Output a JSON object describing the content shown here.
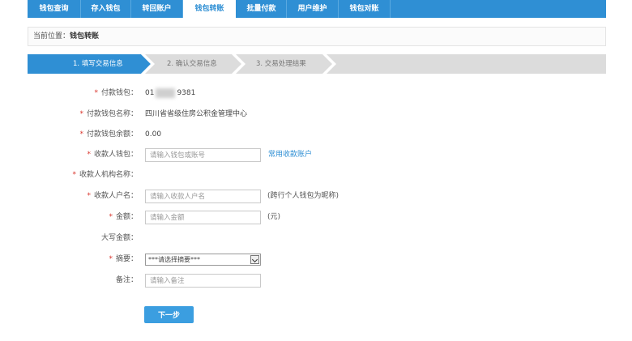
{
  "nav": {
    "tabs": [
      {
        "label": "钱包查询",
        "width": 66
      },
      {
        "label": "存入钱包",
        "width": 62
      },
      {
        "label": "转回账户",
        "width": 64
      },
      {
        "label": "钱包转账",
        "width": 66
      },
      {
        "label": "批量付款",
        "width": 62
      },
      {
        "label": "用户维护",
        "width": 64
      },
      {
        "label": "钱包对账",
        "width": 64
      }
    ],
    "active_index": 3
  },
  "breadcrumb": {
    "prefix": "当前位置：",
    "current": "钱包转账"
  },
  "steps": [
    {
      "label": "1. 填写交易信息",
      "active": true
    },
    {
      "label": "2. 确认交易信息",
      "active": false
    },
    {
      "label": "3. 交易处理结果",
      "active": false
    }
  ],
  "form": {
    "payer_wallet": {
      "label": "付款钱包：",
      "value_prefix": "01",
      "value_suffix": "9381",
      "required": true
    },
    "payer_name": {
      "label": "付款钱包名称：",
      "value": "四川省省级住房公积金管理中心",
      "required": true
    },
    "payer_balance": {
      "label": "付款钱包余额：",
      "value": "0.00",
      "required": true
    },
    "payee_wallet": {
      "label": "收款人钱包：",
      "placeholder": "请输入钱包或账号",
      "required": true,
      "link": "常用收款账户"
    },
    "payee_org": {
      "label": "收款人机构名称：",
      "required": true
    },
    "payee_name": {
      "label": "收款人户名：",
      "placeholder": "请输入收款人户名",
      "required": true,
      "hint": "(跨行个人钱包为昵称)"
    },
    "amount": {
      "label": "金额：",
      "placeholder": "请输入金额",
      "required": true,
      "hint": "(元)"
    },
    "amount_upper": {
      "label": "大写金额："
    },
    "summary": {
      "label": "摘要：",
      "selected": "***请选择摘要***",
      "required": true
    },
    "remark": {
      "label": "备注：",
      "placeholder": "请输入备注"
    }
  },
  "actions": {
    "next_label": "下一步"
  },
  "colors": {
    "primary": "#2f8fd4",
    "required": "#d9342b",
    "step_active": "#2f8fd4",
    "step_inactive": "#dcdcdc"
  }
}
